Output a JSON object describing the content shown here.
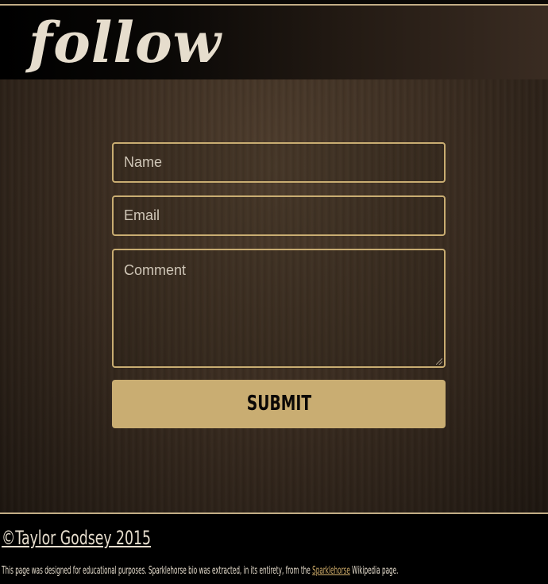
{
  "header": {
    "title": "follow"
  },
  "form": {
    "name_placeholder": "Name",
    "email_placeholder": "Email",
    "comment_placeholder": "Comment",
    "submit_label": "SUBMIT"
  },
  "footer": {
    "copyright": "©Taylor Godsey 2015",
    "note_before": "This page was designed for educational purposes. Sparklehorse bio was extracted, in its entirety, from the ",
    "note_link": "Sparklehorse",
    "note_after": " Wikipedia page."
  },
  "colors": {
    "accent": "#c9ad72",
    "header_text": "#e6ddcd",
    "link": "#d0ad6a",
    "background": "#3b2d21"
  }
}
